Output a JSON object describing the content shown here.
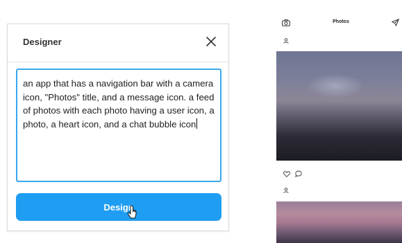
{
  "designer": {
    "title": "Designer",
    "prompt_text": "an app that has a navigation bar with a camera icon, \"Photos\" title, and a message icon. a feed of photos with each photo having a user icon, a photo, a heart icon, and a chat bubble icon",
    "design_button_label": "Design",
    "accent_color": "#1e9df2",
    "icons": {
      "close": "close-icon",
      "cursor": "mouse-pointer-icon"
    }
  },
  "phone_preview": {
    "nav": {
      "title": "Photos",
      "left_icon": "camera-icon",
      "right_icon": "message-icon"
    },
    "feed": [
      {
        "user_icon": "user-icon",
        "photo": "photo-dusk-clouds",
        "actions": [
          "heart-icon",
          "chat-bubble-icon"
        ]
      },
      {
        "user_icon": "user-icon",
        "photo": "photo-pink-sky"
      }
    ]
  }
}
